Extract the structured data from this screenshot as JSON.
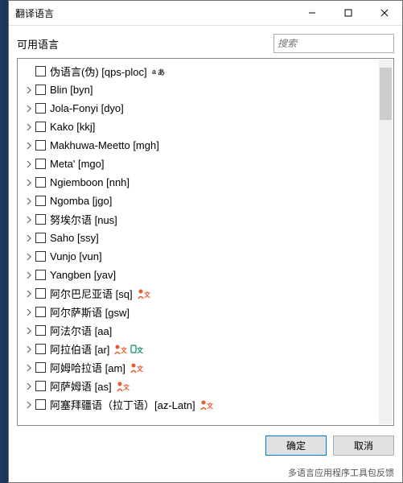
{
  "window": {
    "title": "翻译语言"
  },
  "header": {
    "label": "可用语言",
    "search_placeholder": "搜索"
  },
  "tree": {
    "items": [
      {
        "expandable": false,
        "label": "伪语言(伪) [qps-ploc]",
        "icons": [
          "translate-black"
        ]
      },
      {
        "expandable": true,
        "label": "Blin [byn]",
        "icons": []
      },
      {
        "expandable": true,
        "label": "Jola-Fonyi [dyo]",
        "icons": []
      },
      {
        "expandable": true,
        "label": "Kako [kkj]",
        "icons": []
      },
      {
        "expandable": true,
        "label": "Makhuwa-Meetto [mgh]",
        "icons": []
      },
      {
        "expandable": true,
        "label": "Meta' [mgo]",
        "icons": []
      },
      {
        "expandable": true,
        "label": "Ngiemboon [nnh]",
        "icons": []
      },
      {
        "expandable": true,
        "label": "Ngomba [jgo]",
        "icons": []
      },
      {
        "expandable": true,
        "label": "努埃尔语 [nus]",
        "icons": []
      },
      {
        "expandable": true,
        "label": "Saho [ssy]",
        "icons": []
      },
      {
        "expandable": true,
        "label": "Vunjo [vun]",
        "icons": []
      },
      {
        "expandable": true,
        "label": "Yangben [yav]",
        "icons": []
      },
      {
        "expandable": true,
        "label": "阿尔巴尼亚语 [sq]",
        "icons": [
          "provider-orange"
        ]
      },
      {
        "expandable": true,
        "label": "阿尔萨斯语 [gsw]",
        "icons": []
      },
      {
        "expandable": true,
        "label": "阿法尔语 [aa]",
        "icons": []
      },
      {
        "expandable": true,
        "label": "阿拉伯语 [ar]",
        "icons": [
          "provider-orange",
          "provider-teal"
        ]
      },
      {
        "expandable": true,
        "label": "阿姆哈拉语 [am]",
        "icons": [
          "provider-orange"
        ]
      },
      {
        "expandable": true,
        "label": "阿萨姆语 [as]",
        "icons": [
          "provider-orange"
        ]
      },
      {
        "expandable": true,
        "label": "阿塞拜疆语（拉丁语）[az-Latn]",
        "icons": [
          "provider-orange"
        ]
      }
    ]
  },
  "buttons": {
    "ok": "确定",
    "cancel": "取消"
  },
  "footer": {
    "feedback": "多语言应用程序工具包反馈"
  }
}
